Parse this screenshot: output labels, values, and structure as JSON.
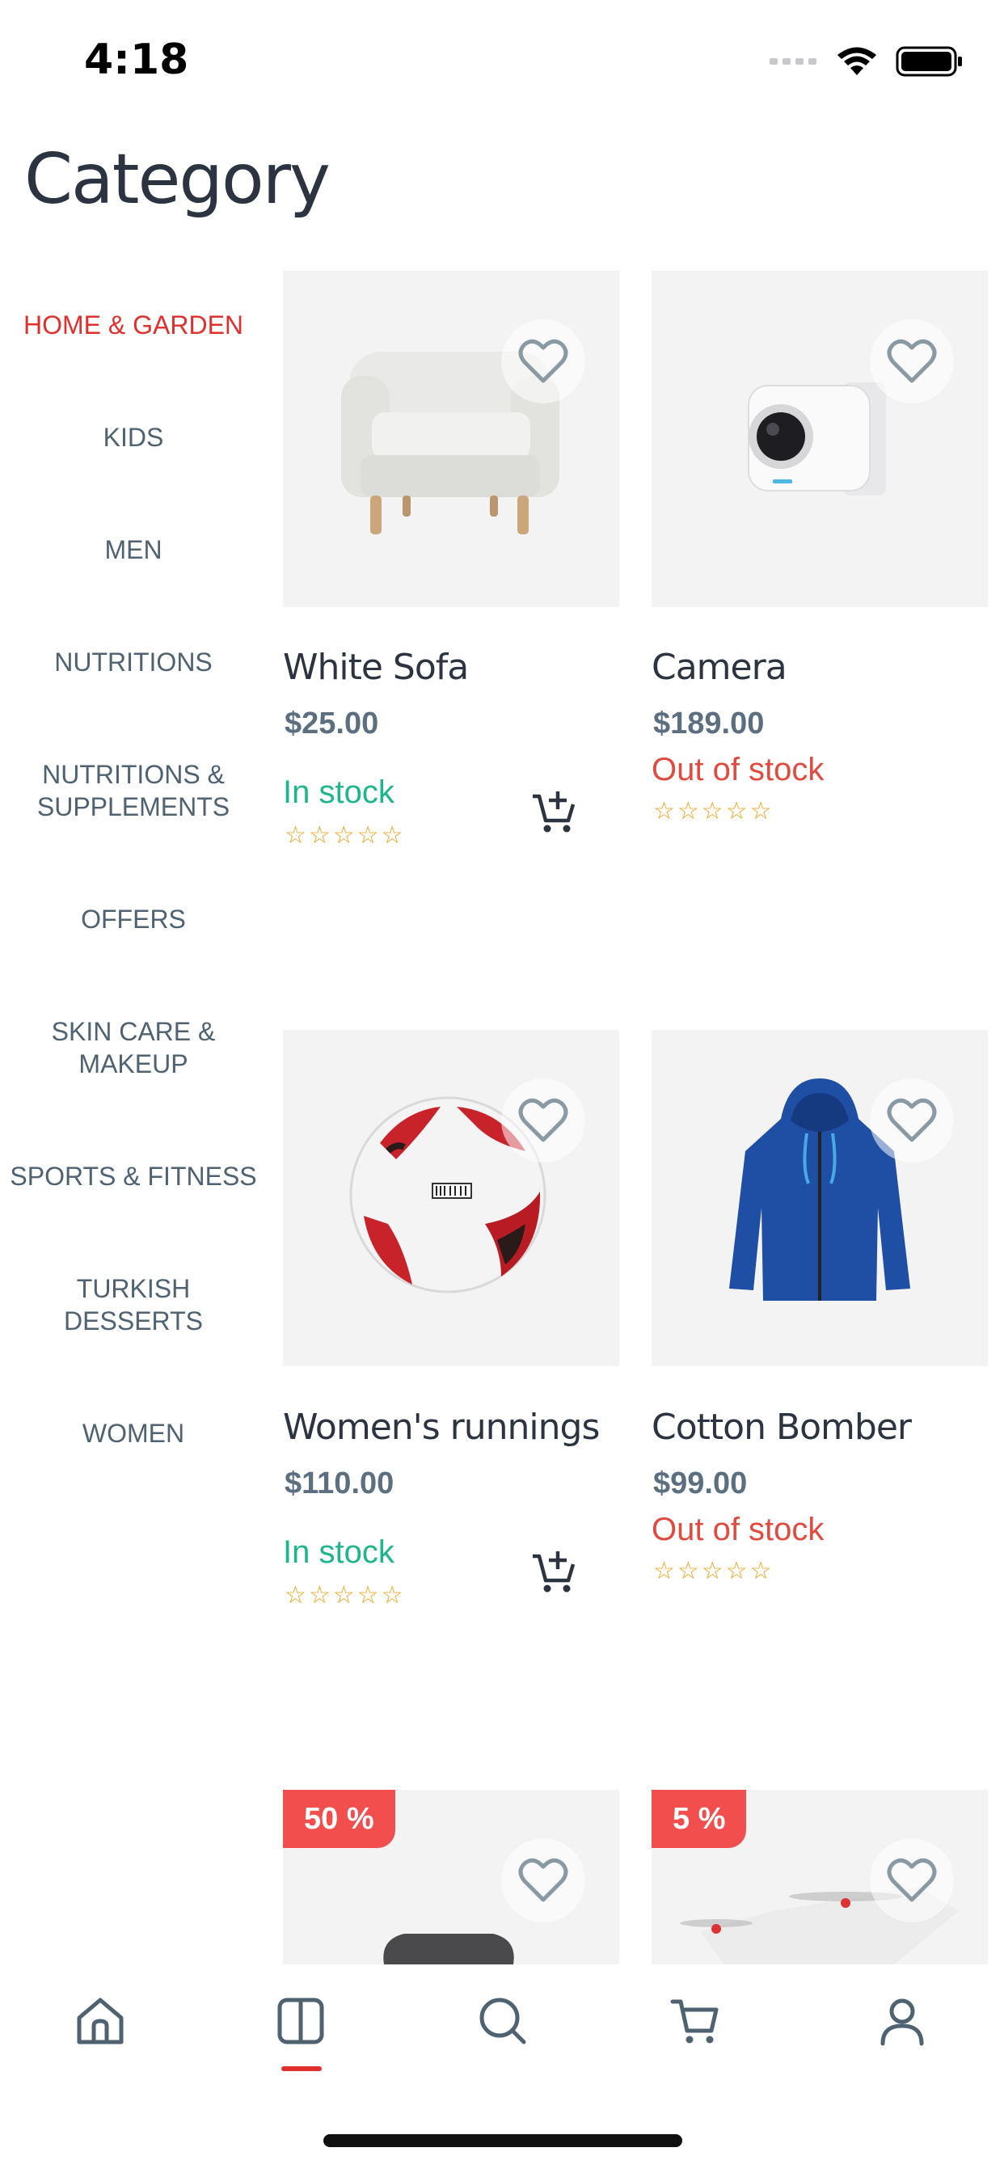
{
  "status": {
    "time": "4:18"
  },
  "page": {
    "title": "Category"
  },
  "sidebar": {
    "categories": [
      {
        "label": "HOME & GARDEN"
      },
      {
        "label": "KIDS"
      },
      {
        "label": "MEN"
      },
      {
        "label": "NUTRITIONS"
      },
      {
        "label": "NUTRITIONS & SUPPLEMENTS"
      },
      {
        "label": "OFFERS"
      },
      {
        "label": "SKIN CARE & MAKEUP"
      },
      {
        "label": "SPORTS & FITNESS"
      },
      {
        "label": "TURKISH DESSERTS"
      },
      {
        "label": "WOMEN"
      }
    ]
  },
  "products": [
    {
      "name": "White Sofa",
      "price": "$25.00",
      "stock": "In stock",
      "rating_stars": "☆☆☆☆☆",
      "rating": 0
    },
    {
      "name": "Camera",
      "price": "$189.00",
      "stock": "Out of stock",
      "rating_stars": "☆☆☆☆☆",
      "rating": 0
    },
    {
      "name": "Women's runnings",
      "price": "$110.00",
      "stock": "In stock",
      "rating_stars": "☆☆☆☆☆",
      "rating": 0
    },
    {
      "name": "Cotton Bomber",
      "price": "$99.00",
      "stock": "Out of stock",
      "rating_stars": "☆☆☆☆☆",
      "rating": 0
    },
    {
      "badge": "50 %"
    },
    {
      "badge": "5 %"
    }
  ],
  "colors": {
    "accent": "#e0302e",
    "in_stock": "#1fb58e",
    "out_of_stock": "#e04a3f",
    "star": "#f0a21a",
    "badge": "#f24e4e"
  },
  "nav": {
    "items": [
      {
        "icon": "home-icon"
      },
      {
        "icon": "category-icon",
        "active": true
      },
      {
        "icon": "search-icon"
      },
      {
        "icon": "cart-icon"
      },
      {
        "icon": "profile-icon"
      }
    ]
  }
}
